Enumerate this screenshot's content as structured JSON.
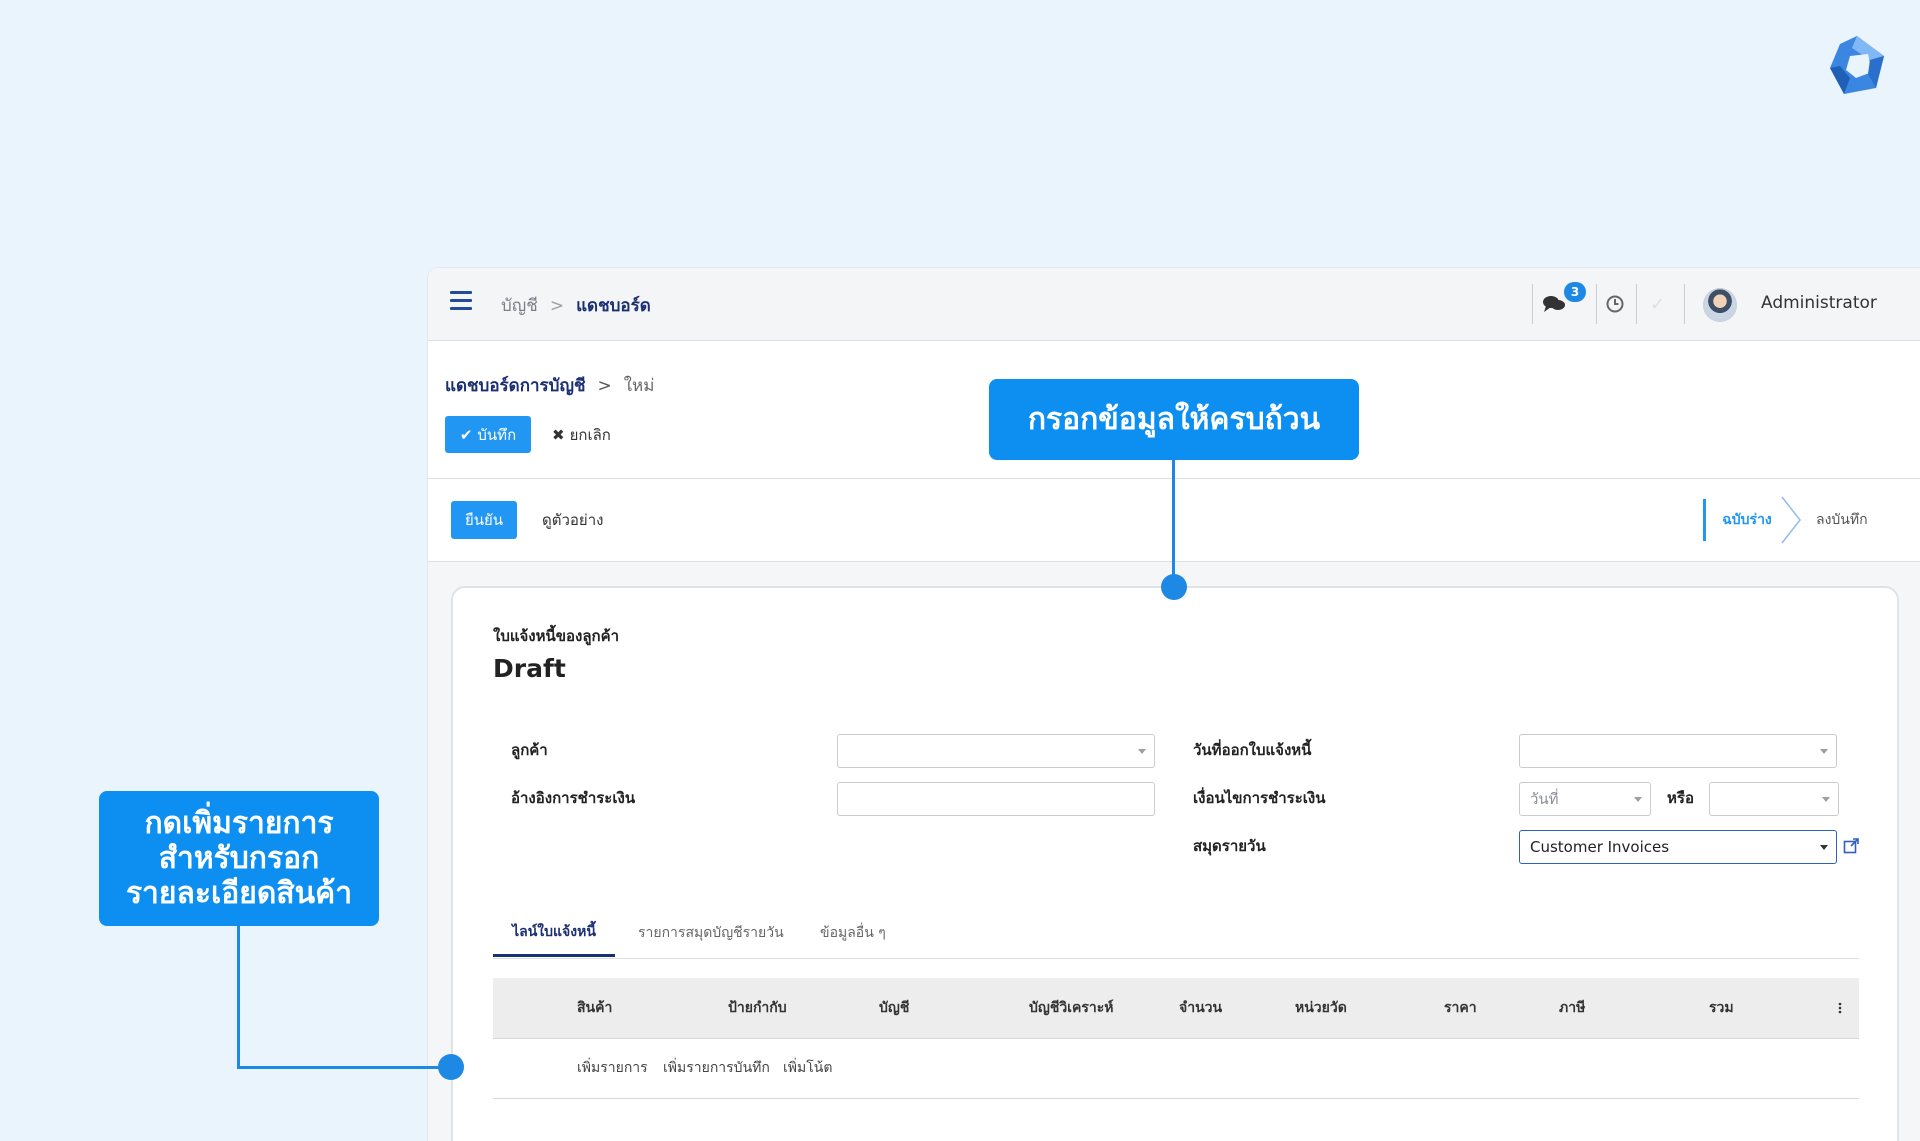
{
  "topbar": {
    "breadcrumb_root": "บัญชี",
    "breadcrumb_sep": ">",
    "breadcrumb_current": "แดชบอร์ด",
    "chat_badge": "3",
    "user_name": "Administrator"
  },
  "control_panel": {
    "breadcrumb_parent": "แดชบอร์ดการบัญชี",
    "breadcrumb_sep": ">",
    "breadcrumb_current": "ใหม่",
    "save_label": "บันทึก",
    "cancel_label": "ยกเลิก"
  },
  "statusbar": {
    "confirm_label": "ยืนยัน",
    "preview_label": "ดูตัวอย่าง",
    "stages": [
      "ฉบับร่าง",
      "ลงบันทึก"
    ],
    "active_stage": "ฉบับร่าง"
  },
  "form": {
    "doc_type": "ใบแจ้งหนี้ของลูกค้า",
    "doc_status": "Draft",
    "fields": {
      "customer": "ลูกค้า",
      "payment_ref": "อ้างอิงการชำระเงิน",
      "invoice_date": "วันที่ออกใบแจ้งหนี้",
      "payment_terms": "เงื่อนไขการชำระเงิน",
      "journal": "สมุดรายวัน"
    },
    "payment_terms_placeholder": "วันที่",
    "or_label": "หรือ",
    "journal_value": "Customer Invoices"
  },
  "tabs": [
    "ไลน์ใบแจ้งหนี้",
    "รายการสมุดบัญชีรายวัน",
    "ข้อมูลอื่น ๆ"
  ],
  "table": {
    "columns": [
      "สินค้า",
      "ป้ายกำกับ",
      "บัญชี",
      "บัญชีวิเคราะห์",
      "จำนวน",
      "หน่วยวัด",
      "ราคา",
      "ภาษี",
      "รวม"
    ],
    "actions": [
      "เพิ่มรายการ",
      "เพิ่มรายการบันทึก",
      "เพิ่มโน้ต"
    ]
  },
  "callouts": {
    "fill_info": "กรอกข้อมูลให้ครบถ้วน",
    "add_line": [
      "กดเพิ่มรายการ",
      "สำหรับกรอก",
      "รายละเอียดสินค้า"
    ]
  },
  "colors": {
    "accent": "#2196f3",
    "callout": "#0c8ff0",
    "navy": "#1b2f73"
  },
  "icons": [
    "brand-logo-icon",
    "hamburger-icon",
    "chat-icon",
    "clock-icon",
    "check-icon",
    "close-icon",
    "external-link-icon",
    "kebab-menu-icon"
  ]
}
